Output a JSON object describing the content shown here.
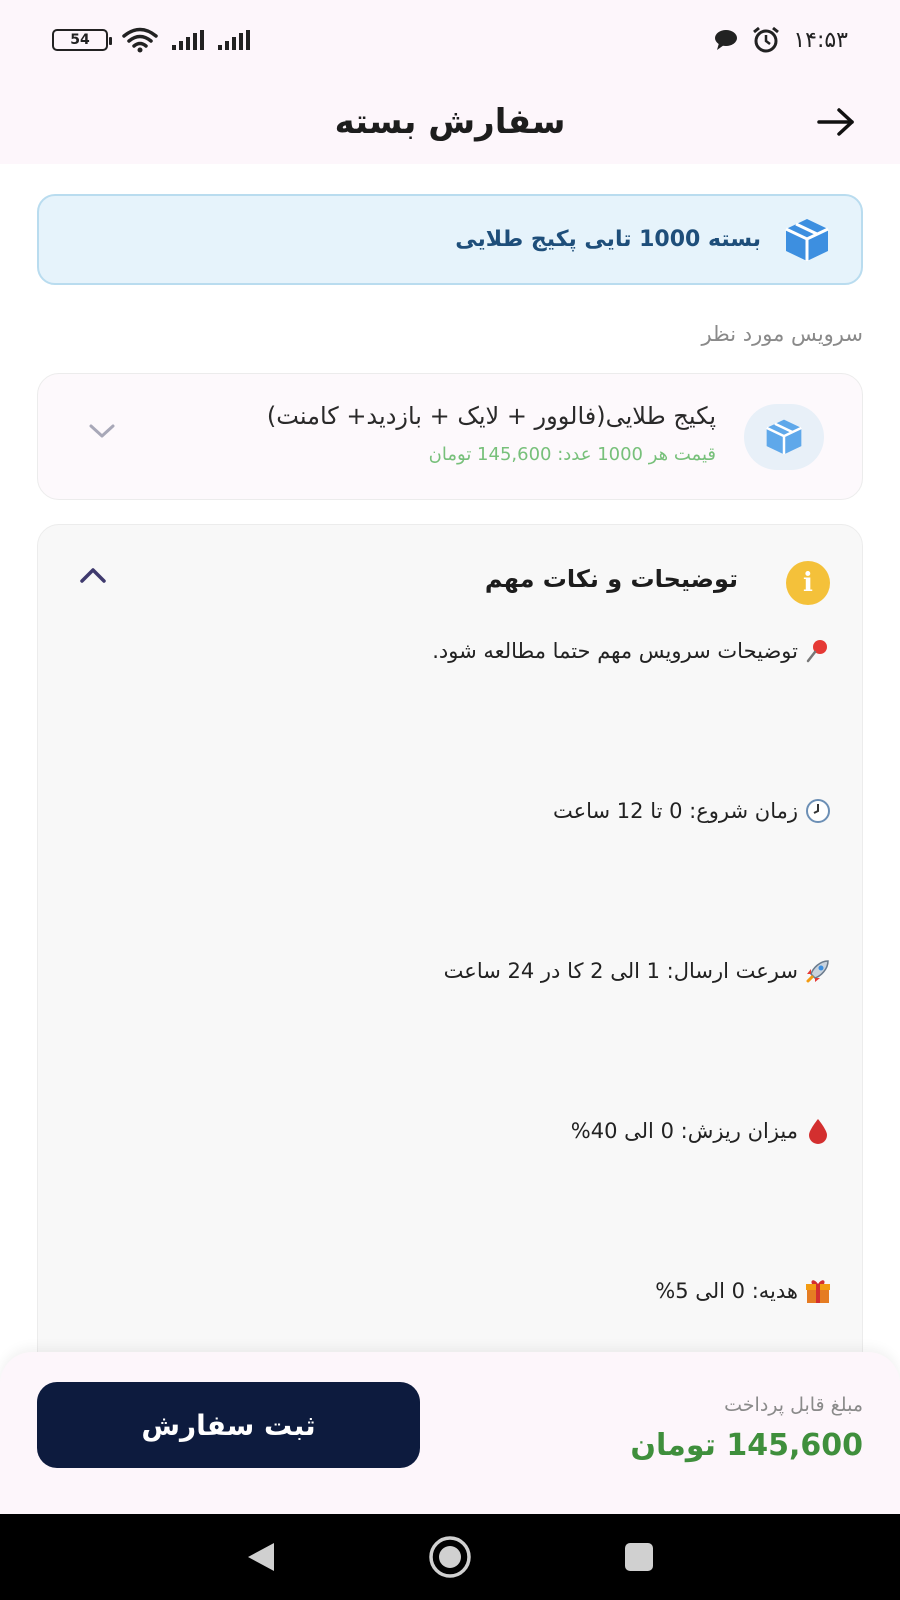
{
  "status_bar": {
    "battery": "54",
    "time": "۱۴:۵۳"
  },
  "header": {
    "title": "سفارش بسته"
  },
  "banner": {
    "text": "بسته 1000 تایی پکیج طلایی"
  },
  "service_section": {
    "label": "سرویس مورد نظر",
    "selected_name": "پکیج طلایی(فالوور + لایک + بازدید+ کامنت)",
    "selected_price": "قیمت هر 1000 عدد: 145,600 تومان"
  },
  "description": {
    "title": "توضیحات و نکات مهم",
    "info_glyph": "i",
    "lines": [
      "توضیحات سرویس مهم حتما مطالعه شود.",
      "زمان شروع: 0 تا 12 ساعت",
      "سرعت ارسال: 1 الی 2 کا در 24 ساعت",
      "میزان ریزش: 0 الی 40%",
      "هدیه: 0 الی 5%"
    ],
    "line_icons": [
      "pushpin-icon",
      "clock-icon",
      "rocket-icon",
      "drop-icon",
      "gift-icon"
    ]
  },
  "footer": {
    "submit_label": "ثبت سفارش",
    "payable_label": "مبلغ قابل پرداخت",
    "payable_amount": "145,600 تومان"
  },
  "colors": {
    "header_bg": "#fdf6fb",
    "banner_bg": "#e6f3fb",
    "banner_text": "#1e4e7a",
    "price_green": "#77c07a",
    "amount_green": "#3f8f3c",
    "submit_bg": "#0d1b3e",
    "info_yellow": "#f4c13a"
  }
}
